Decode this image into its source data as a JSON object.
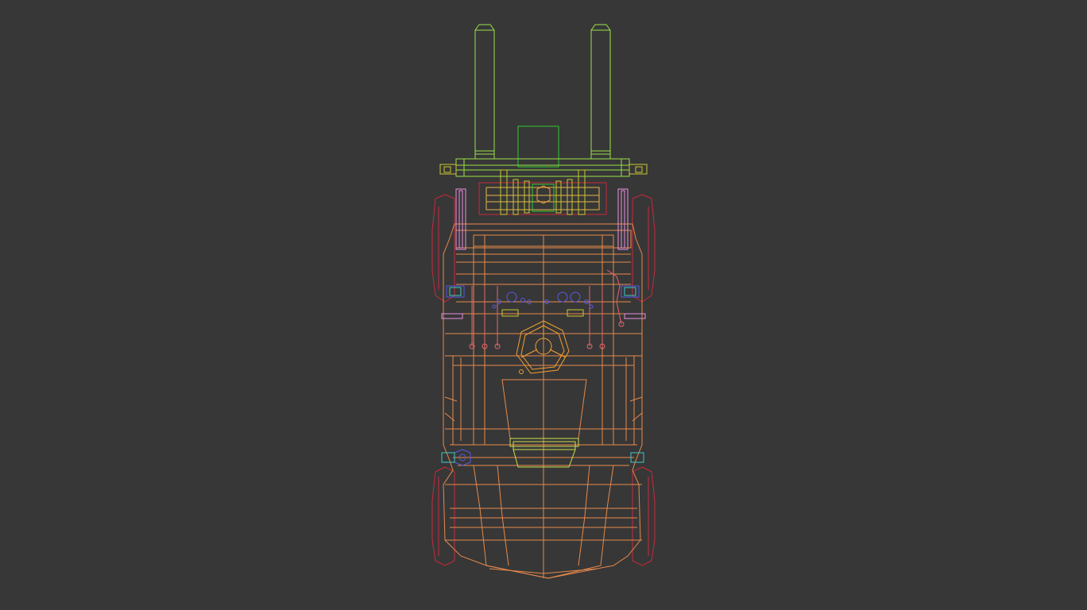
{
  "viewport": {
    "background": "#373737",
    "colors": {
      "forks": "#9be04a",
      "carriage": "#c8c832",
      "body": "#e8894a",
      "tires": "#c8283c",
      "cylinders": "#e8646e",
      "steering": "#f5a030",
      "overhead_guard": "#e890e0",
      "lights_blue": "#5a5ae6",
      "cyan_parts": "#3cc8c8",
      "seat": "#c8e050",
      "green_box": "#32c832",
      "chain": "#e8b44a"
    },
    "icons": {
      "steering_wheel": "heptagon-wheel-icon",
      "wheel_hub": "hexagon-hub-icon"
    }
  }
}
